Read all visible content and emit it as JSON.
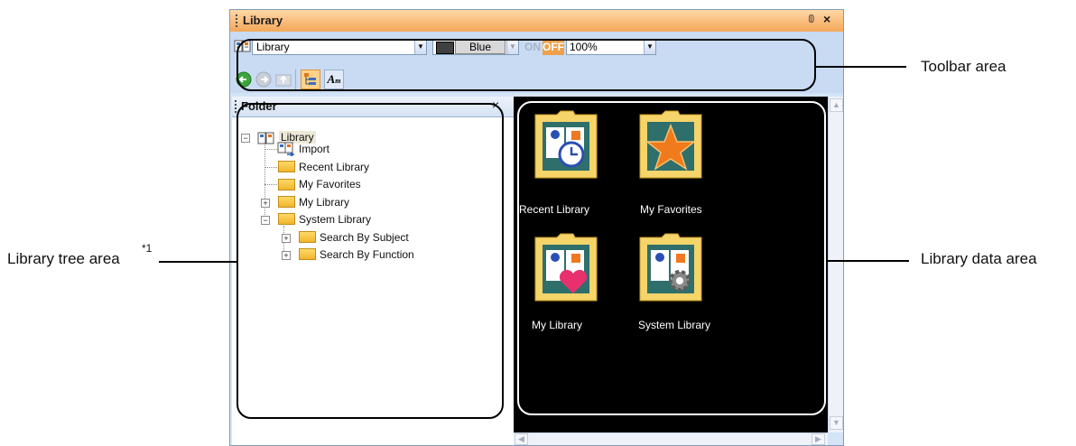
{
  "window": {
    "title": "Library"
  },
  "toolbar": {
    "library_combo": "Library",
    "color_combo": "Blue",
    "swatch_color": "#404040",
    "on_label": "ON",
    "off_label": "OFF",
    "zoom_combo": "100%",
    "buttons": [
      "back-icon",
      "forward-icon",
      "up-folder-icon",
      "tree-view-icon",
      "font-icon"
    ]
  },
  "folder_pane": {
    "title": "Folder",
    "tree": [
      {
        "label": "Library",
        "expanded": true
      },
      {
        "label": "Import"
      },
      {
        "label": "Recent Library"
      },
      {
        "label": "My Favorites"
      },
      {
        "label": "My Library",
        "expanded": false
      },
      {
        "label": "System Library",
        "expanded": true
      },
      {
        "label": "Search By Subject",
        "expanded": false
      },
      {
        "label": "Search By Function",
        "expanded": false
      }
    ]
  },
  "data_pane": {
    "items": [
      {
        "label": "Recent Library",
        "icon": "clock-book-icon"
      },
      {
        "label": "My Favorites",
        "icon": "star-icon"
      },
      {
        "label": "My Library",
        "icon": "heart-book-icon"
      },
      {
        "label": "System Library",
        "icon": "gear-book-icon"
      }
    ]
  },
  "annotations": {
    "toolbar_area": "Toolbar area",
    "tree_area": "Library tree area",
    "tree_area_note": "*1",
    "data_area": "Library data area"
  },
  "colors": {
    "title_bar": "#f4a758",
    "toolbar_bg": "#c9dbf3",
    "data_bg": "#000000",
    "on_color": "#a5b4c8",
    "off_color": "#f0a04b"
  }
}
